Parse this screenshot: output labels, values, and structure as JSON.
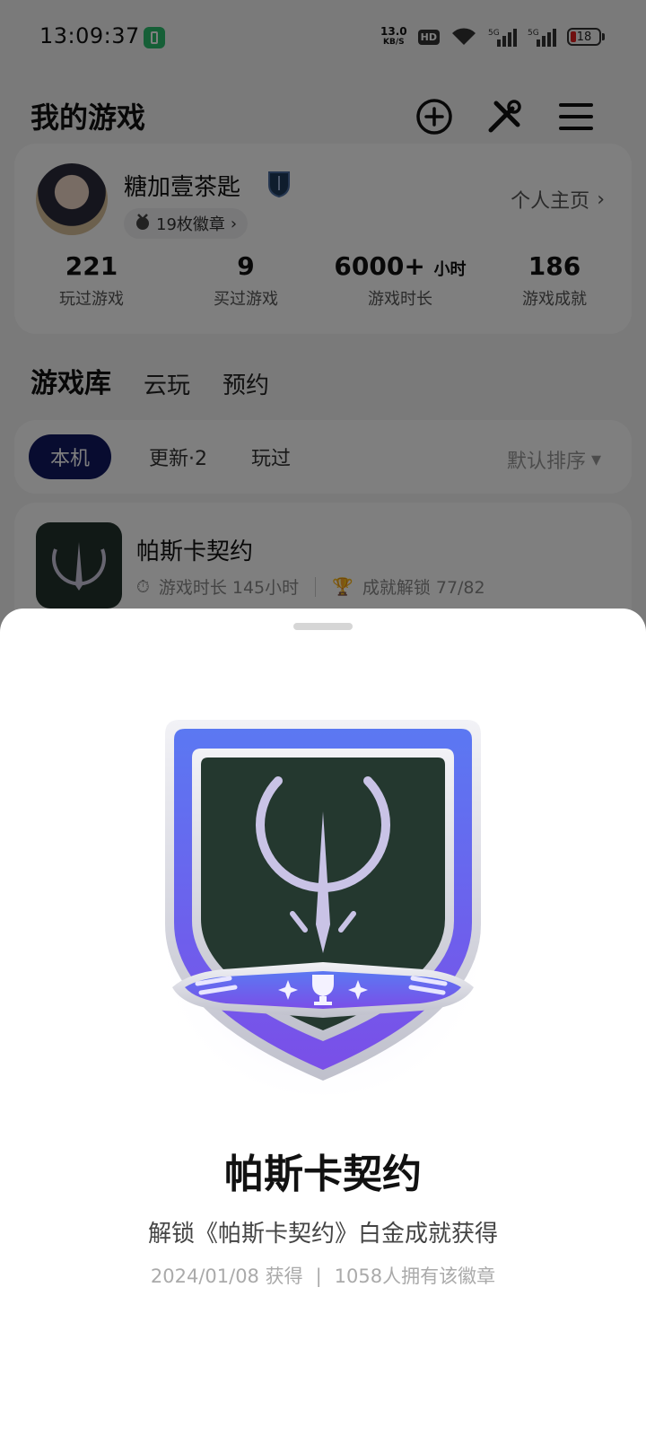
{
  "status_bar": {
    "time": "13:09:37",
    "net_speed_value": "13.0",
    "net_speed_unit": "KB/S",
    "hd_label": "HD",
    "signal_1": "5G",
    "signal_2": "5G",
    "battery_level": "18",
    "accent": "#2dbf6e"
  },
  "header": {
    "title": "我的游戏",
    "icons": [
      "add-circle-icon",
      "tools-icon",
      "menu-icon"
    ]
  },
  "profile": {
    "username": "糖加壹茶匙",
    "badge_count": "19枚徽章",
    "homepage_label": "个人主页",
    "stats": [
      {
        "value": "221",
        "unit": "",
        "label": "玩过游戏"
      },
      {
        "value": "9",
        "unit": "",
        "label": "买过游戏"
      },
      {
        "value": "6000+",
        "unit": "小时",
        "label": "游戏时长"
      },
      {
        "value": "186",
        "unit": "",
        "label": "游戏成就"
      }
    ]
  },
  "tabs": [
    {
      "label": "游戏库",
      "active": true
    },
    {
      "label": "云玩",
      "active": false
    },
    {
      "label": "预约",
      "active": false
    }
  ],
  "filters": {
    "chips": [
      "本机",
      "更新·2",
      "玩过"
    ],
    "active_chip": "本机",
    "sort_label": "默认排序"
  },
  "game": {
    "title": "帕斯卡契约",
    "playtime": "游戏时长 145小时",
    "achievements": "成就解锁 77/82"
  },
  "sheet": {
    "title": "帕斯卡契约",
    "description": "解锁《帕斯卡契约》白金成就获得",
    "date": "2024/01/08 获得",
    "separator": "|",
    "owners": "1058人拥有该徽章",
    "badge_colors": {
      "frame": "#6a5cf0",
      "inner": "#24382f",
      "emblem": "#c9c3e6"
    }
  }
}
